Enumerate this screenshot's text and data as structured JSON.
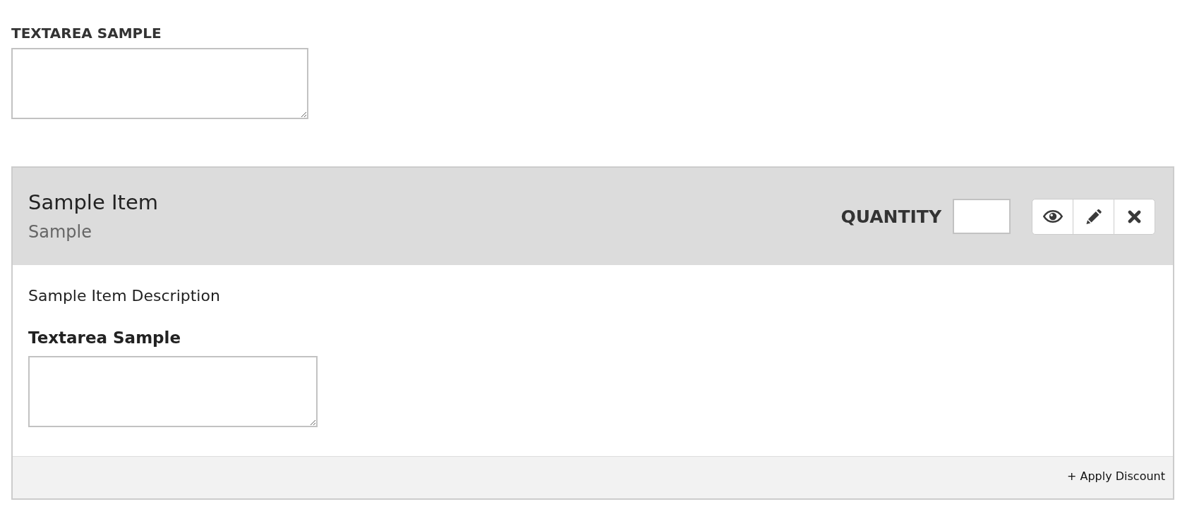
{
  "top_field": {
    "label": "TEXTAREA SAMPLE"
  },
  "item_panel": {
    "title": "Sample Item",
    "subtitle": "Sample",
    "quantity_label": "QUANTITY",
    "actions": [
      {
        "kind": "view"
      },
      {
        "kind": "edit"
      },
      {
        "kind": "remove"
      }
    ],
    "description": "Sample Item Description",
    "field": {
      "label": "Textarea Sample"
    },
    "footer_link": "+ Apply Discount"
  }
}
